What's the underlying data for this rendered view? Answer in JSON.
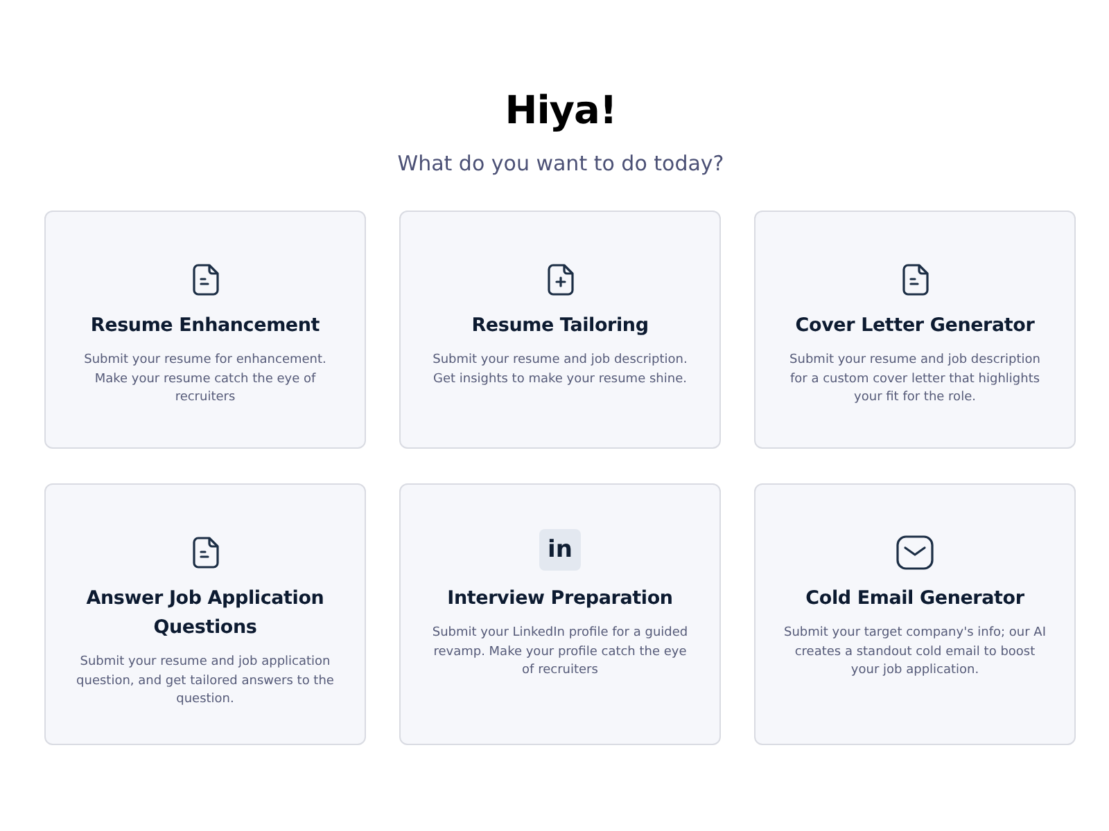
{
  "heading": "Hiya!",
  "subheading": "What do you want to do today?",
  "cards": [
    {
      "kind": "document",
      "title": "Resume Enhancement",
      "description": "Submit your resume for enhancement. Make your resume catch the eye of recruiters"
    },
    {
      "kind": "add",
      "title": "Resume Tailoring",
      "description": "Submit your resume and job description. Get insights to make your resume shine."
    },
    {
      "kind": "document",
      "title": "Cover Letter Generator",
      "description": "Submit your resume and job description for a custom cover letter that highlights your fit for the role."
    },
    {
      "kind": "document",
      "title": "Answer Job Application Questions",
      "description": "Submit your resume and job application question, and get tailored answers to the question."
    },
    {
      "kind": "badge",
      "icon_label": "in",
      "title": "Interview Preparation",
      "description": "Submit your LinkedIn profile for a guided revamp. Make your profile catch the eye of recruiters"
    },
    {
      "kind": "mail",
      "title": "Cold Email Generator",
      "description": "Submit your target company's info; our AI creates a standout cold email to boost your job application."
    }
  ]
}
